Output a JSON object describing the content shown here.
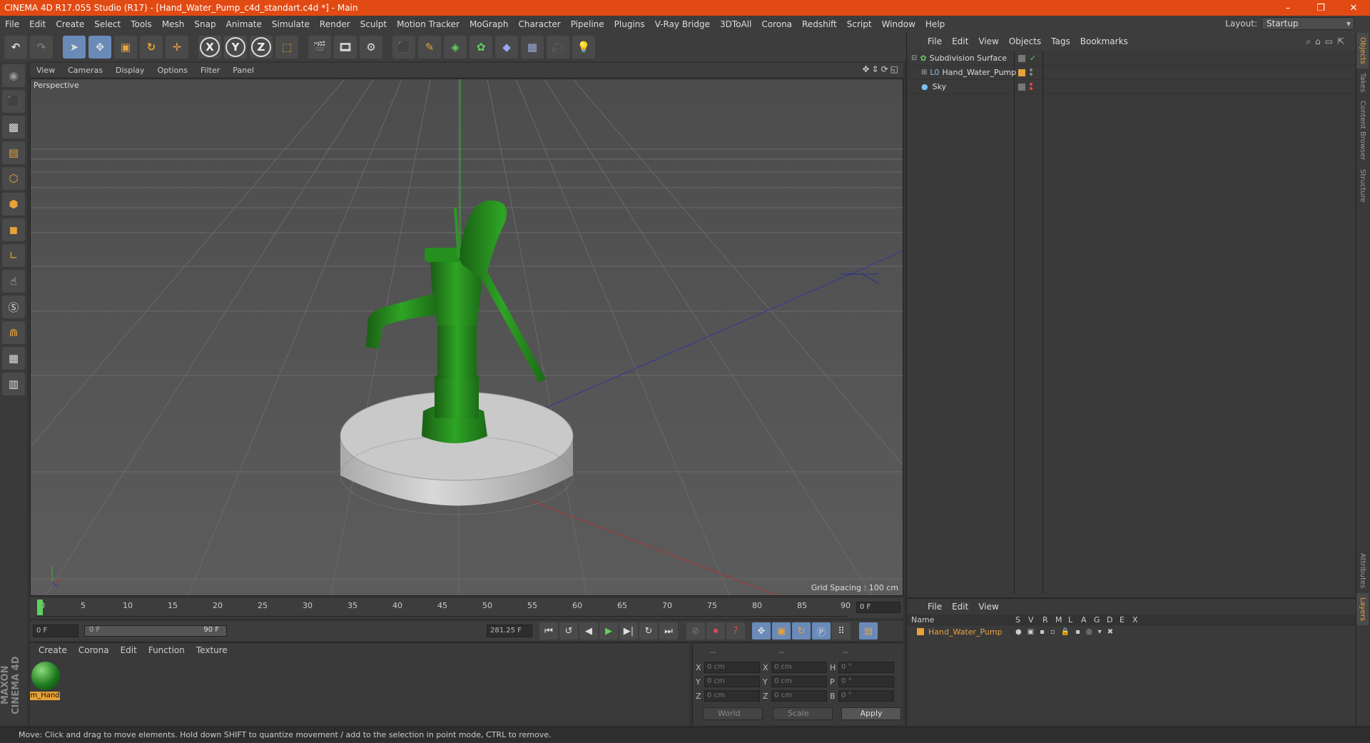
{
  "window": {
    "title": "CINEMA 4D R17.055 Studio (R17) - [Hand_Water_Pump_c4d_standart.c4d *] - Main",
    "minimize": "–",
    "maximize": "❐",
    "close": "✕"
  },
  "menubar": {
    "items": [
      "File",
      "Edit",
      "Create",
      "Select",
      "Tools",
      "Mesh",
      "Snap",
      "Animate",
      "Simulate",
      "Render",
      "Sculpt",
      "Motion Tracker",
      "MoGraph",
      "Character",
      "Pipeline",
      "Plugins",
      "V-Ray Bridge",
      "3DToAll",
      "Corona",
      "Redshift",
      "Script",
      "Window",
      "Help"
    ],
    "layout_label": "Layout:",
    "layout_value": "Startup"
  },
  "toolbar": {
    "axis_x": "X",
    "axis_y": "Y",
    "axis_z": "Z"
  },
  "viewport": {
    "menu": [
      "View",
      "Cameras",
      "Display",
      "Options",
      "Filter",
      "Panel"
    ],
    "label": "Perspective",
    "grid_spacing": "Grid Spacing : 100 cm"
  },
  "timeline": {
    "ticks": [
      "0",
      "5",
      "10",
      "15",
      "20",
      "25",
      "30",
      "35",
      "40",
      "45",
      "50",
      "55",
      "60",
      "65",
      "70",
      "75",
      "80",
      "85",
      "90"
    ],
    "current_frame": "0 F"
  },
  "transport": {
    "start": "0 F",
    "range_start": "0 F",
    "range_end": "90 F",
    "fps_field": "281.25 F"
  },
  "material_panel": {
    "menu": [
      "Create",
      "Corona",
      "Edit",
      "Function",
      "Texture"
    ],
    "material_name": "m_Hand"
  },
  "coordinates": {
    "headers": [
      "--",
      "--",
      "--"
    ],
    "rows": [
      {
        "l1": "X",
        "v1": "0 cm",
        "l2": "X",
        "v2": "0 cm",
        "l3": "H",
        "v3": "0 °"
      },
      {
        "l1": "Y",
        "v1": "0 cm",
        "l2": "Y",
        "v2": "0 cm",
        "l3": "P",
        "v3": "0 °"
      },
      {
        "l1": "Z",
        "v1": "0 cm",
        "l2": "Z",
        "v2": "0 cm",
        "l3": "B",
        "v3": "0 °"
      }
    ],
    "mode": "World",
    "scale": "Scale",
    "apply": "Apply"
  },
  "object_manager": {
    "menu": [
      "File",
      "Edit",
      "View",
      "Objects",
      "Tags",
      "Bookmarks"
    ],
    "objects": [
      "Subdivision Surface",
      "Hand_Water_Pump",
      "Sky"
    ]
  },
  "layer_manager": {
    "menu": [
      "File",
      "Edit",
      "View"
    ],
    "columns": [
      "Name",
      "S",
      "V",
      "R",
      "M",
      "L",
      "A",
      "G",
      "D",
      "E",
      "X"
    ],
    "layer_name": "Hand_Water_Pump"
  },
  "right_tabs": [
    "Objects",
    "Takes",
    "Content Browser",
    "Structure",
    "Attributes",
    "Layers"
  ],
  "branding": "MAXON CINEMA 4D",
  "status": "Move: Click and drag to move elements. Hold down SHIFT to quantize movement / add to the selection in point mode, CTRL to remove.",
  "colors": {
    "titlebar": "#e24a13",
    "accent": "#e8a23a",
    "pump_green": "#2b8a22"
  }
}
